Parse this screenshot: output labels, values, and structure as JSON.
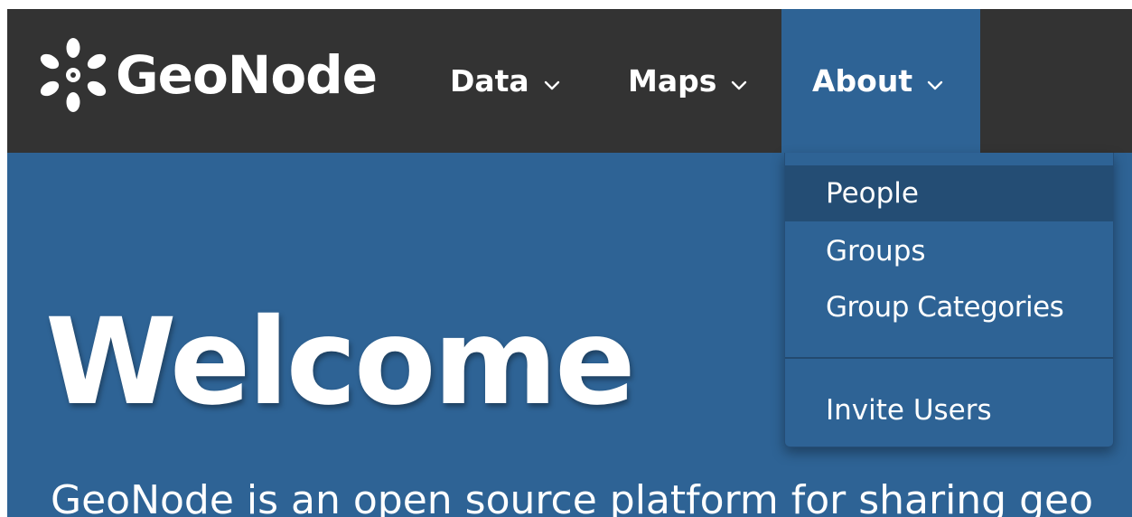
{
  "colors": {
    "navbar_bg": "#333333",
    "primary": "#2e6395",
    "active_item_bg": "#244d74",
    "text": "#ffffff"
  },
  "navbar": {
    "brand": {
      "icon": "geonode-logo-icon",
      "name": "GeoNode"
    },
    "items": [
      {
        "label": "Data",
        "icon": "chevron-down-icon",
        "active": false
      },
      {
        "label": "Maps",
        "icon": "chevron-down-icon",
        "active": false
      },
      {
        "label": "About",
        "icon": "chevron-down-icon",
        "active": true
      }
    ]
  },
  "about_menu": {
    "items": [
      {
        "label": "People",
        "highlighted": true
      },
      {
        "label": "Groups",
        "highlighted": false
      },
      {
        "label": "Group Categories",
        "highlighted": false
      },
      {
        "label": "Invite Users",
        "highlighted": false
      }
    ]
  },
  "hero": {
    "title": "Welcome",
    "subtitle": "GeoNode is an open source platform for sharing geo"
  }
}
